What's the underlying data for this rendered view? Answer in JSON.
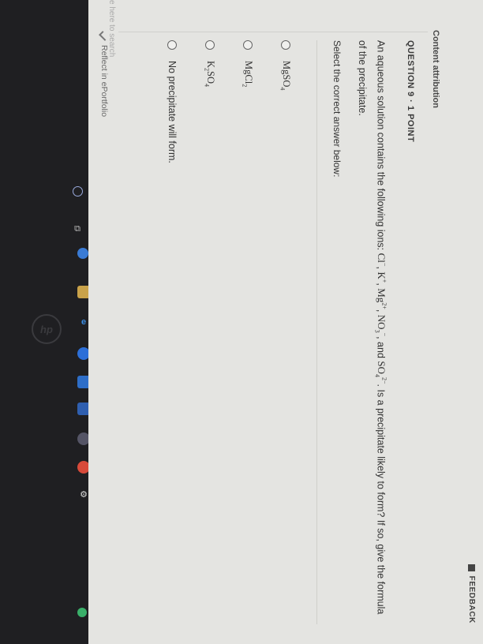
{
  "header": {
    "feedback_label": "FEEDBACK",
    "content_attribution": "Content attribution"
  },
  "question": {
    "number_label": "QUESTION 9 · 1 POINT",
    "text_prefix": "An aqueous solution contains the following ions:",
    "ions": {
      "cl": "Cl",
      "cl_sup": "−",
      "k": "K",
      "k_sup": "+",
      "mg": "Mg",
      "mg_sup": "2+",
      "no3": "NO",
      "no3_sub": "3",
      "no3_sup": "−",
      "so4": "SO",
      "so4_sub": "4",
      "so4_sup": "2−"
    },
    "and_word": "and",
    "text_suffix": ". Is a precipitate likely to form? If so, give the formula of the precipitate.",
    "select_label": "Select the correct answer below:"
  },
  "options": [
    {
      "base": "MgSO",
      "sub": "4",
      "tail": ""
    },
    {
      "base": "MgCl",
      "sub": "2",
      "tail": ""
    },
    {
      "base": "K",
      "sub": "2",
      "tail": "SO",
      "sub2": "4"
    },
    {
      "base": "No precipitate will form.",
      "sub": "",
      "tail": ""
    }
  ],
  "footer": {
    "reflect_label": "Reflect in ePortfolio",
    "search_placeholder": "e here to search"
  },
  "icons": [
    "windows-icon",
    "task-view-icon",
    "edge-icon",
    "file-explorer-icon",
    "store-icon",
    "chrome-icon",
    "settings-icon"
  ]
}
